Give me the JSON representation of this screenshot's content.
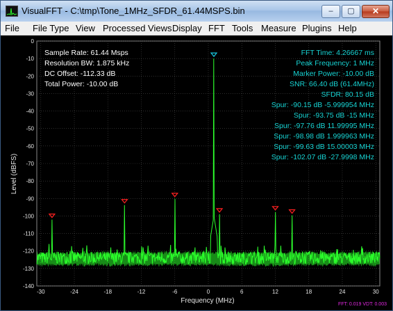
{
  "window": {
    "title": "VisualFFT - C:\\tmp\\Tone_1MHz_SFDR_61.44MSPS.bin",
    "buttons": {
      "minimize": "–",
      "maximize": "▢",
      "close": "✕"
    },
    "icon": "waveform-app-icon"
  },
  "menu": [
    "File",
    "File Type",
    "View",
    "Processed Views",
    "Display",
    "FFT",
    "Tools",
    "Measure",
    "Plugins",
    "Help"
  ],
  "info_left": [
    "Sample Rate: 61.44 Msps",
    "Resolution BW: 1.875 kHz",
    "DC Offset: -112.33 dB",
    "Total Power: -10.00 dB"
  ],
  "info_right": [
    "FFT Time: 4.26667 ms",
    "Peak Frequency: 1 MHz",
    "Marker Power: -10.00 dB",
    "SNR: 66.40 dB (61.4MHz)",
    "SFDR: 80.15 dB",
    "Spur: -90.15 dB -5.999954 MHz",
    "Spur: -93.75 dB -15 MHz",
    "Spur: -97.76 dB 11.99995 MHz",
    "Spur: -98.98 dB 1.999963 MHz",
    "Spur: -99.63 dB 15.00003 MHz",
    "Spur: -102.07 dB -27.9998 MHz"
  ],
  "status": "FFT: 0.019 VDT: 0.003",
  "colors": {
    "trace": "#2cff2c",
    "grid": "#4a4a4a",
    "info_left": "#ffffff",
    "info_right": "#17d4d4",
    "spur_marker": "#ff2020",
    "peak_marker": "#18c8e0",
    "status": "#e028e0"
  },
  "chart_data": {
    "type": "line",
    "xlabel": "Frequency (MHz)",
    "ylabel": "Level (dBFS)",
    "xlim": [
      -30.72,
      30.72
    ],
    "ylim": [
      -140,
      0
    ],
    "xticks": [
      -30,
      -24,
      -18,
      -12,
      -6,
      0,
      6,
      12,
      18,
      24,
      30
    ],
    "yticks": [
      0,
      -10,
      -20,
      -30,
      -40,
      -50,
      -60,
      -70,
      -80,
      -90,
      -100,
      -110,
      -120,
      -130,
      -140
    ],
    "grid": true,
    "noise_floor": -124,
    "peak": {
      "x": 1,
      "y": -10
    },
    "spurs": [
      {
        "x": -5.999954,
        "y": -90.15
      },
      {
        "x": -15,
        "y": -93.75
      },
      {
        "x": 11.99995,
        "y": -97.76
      },
      {
        "x": 1.999963,
        "y": -98.98
      },
      {
        "x": 15.00003,
        "y": -99.63
      },
      {
        "x": -27.9998,
        "y": -102.07
      }
    ],
    "minor_spurs": [
      {
        "x": -28.5,
        "y": -116
      },
      {
        "x": -10.8,
        "y": -117
      },
      {
        "x": 13,
        "y": -117
      },
      {
        "x": 3,
        "y": -118
      },
      {
        "x": 23,
        "y": -119
      },
      {
        "x": -17.5,
        "y": -118
      }
    ]
  }
}
